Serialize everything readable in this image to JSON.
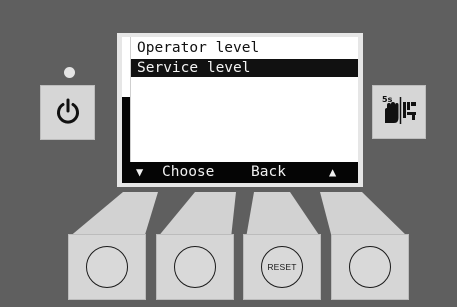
{
  "display": {
    "menu_items": [
      {
        "label": "Operator level",
        "selected": false
      },
      {
        "label": "Service level",
        "selected": true
      }
    ],
    "softkeys": {
      "left_arrow": "▼",
      "choose": "Choose",
      "back": "Back",
      "right_arrow": "▲"
    }
  },
  "controls": {
    "power_icon": "power-icon",
    "manual_icon": "manual-mode-hand-icon",
    "manual_badge": "5s",
    "reset_label": "RESET"
  },
  "colors": {
    "panel": "#5f5f5f",
    "button": "#d6d6d6",
    "screen": "#050505",
    "highlight": "#111111"
  }
}
